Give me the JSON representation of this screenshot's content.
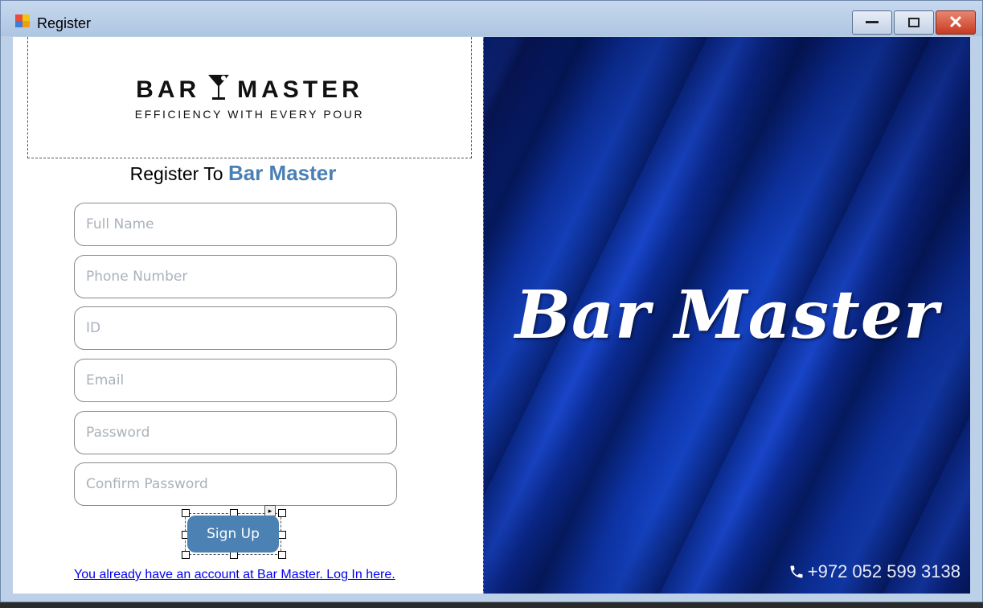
{
  "window": {
    "title": "Register",
    "close_glyph": "✕"
  },
  "logo": {
    "word_left": "BAR",
    "word_right": "MASTER",
    "tagline": "EFFICIENCY WITH EVERY POUR",
    "icon": "martini-glass-icon"
  },
  "heading": {
    "prefix": "Register To ",
    "brand": "Bar Master"
  },
  "form": {
    "full_name": {
      "placeholder": "Full Name",
      "value": ""
    },
    "phone": {
      "placeholder": "Phone Number",
      "value": ""
    },
    "id": {
      "placeholder": "ID",
      "value": ""
    },
    "email": {
      "placeholder": "Email",
      "value": ""
    },
    "password": {
      "placeholder": "Password",
      "value": ""
    },
    "confirm_password": {
      "placeholder": "Confirm Password",
      "value": ""
    },
    "signup_label": "Sign Up",
    "login_link": "You already have an account at Bar Master. Log In here."
  },
  "banner": {
    "title": "Bar Master",
    "phone": "+972 052 599 3138",
    "phone_icon": "phone-icon"
  },
  "colors": {
    "brand": "#4a7fb5",
    "button": "#4b82b3",
    "link": "#0000ee",
    "banner_blue": "#1442c0"
  }
}
